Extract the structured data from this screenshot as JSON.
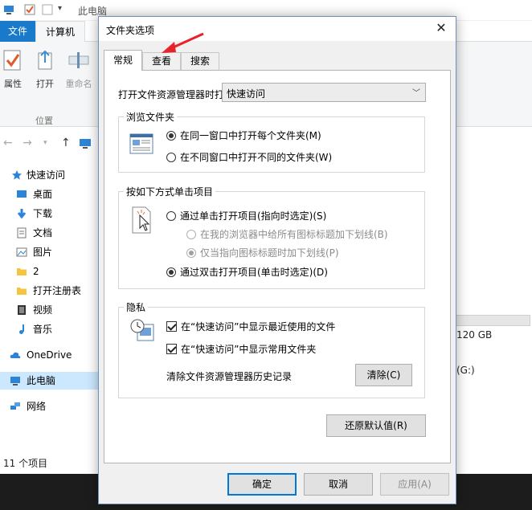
{
  "explorer": {
    "title": "此电脑",
    "tabs": {
      "file": "文件",
      "computer": "计算机"
    },
    "ribbon": {
      "properties": "属性",
      "open": "打开",
      "rename": "重命名",
      "group_location": "位置"
    },
    "sidebar": [
      {
        "label": "快速访问",
        "icon": "star-icon"
      },
      {
        "label": "桌面",
        "icon": "desktop-icon"
      },
      {
        "label": "下载",
        "icon": "download-icon"
      },
      {
        "label": "文档",
        "icon": "document-icon"
      },
      {
        "label": "图片",
        "icon": "picture-icon"
      },
      {
        "label": "2",
        "icon": "folder-icon"
      },
      {
        "label": "打开注册表",
        "icon": "folder-icon"
      },
      {
        "label": "视频",
        "icon": "video-icon"
      },
      {
        "label": "音乐",
        "icon": "music-icon"
      },
      {
        "label": "OneDrive",
        "icon": "cloud-icon"
      },
      {
        "label": "此电脑",
        "icon": "computer-icon"
      },
      {
        "label": "网络",
        "icon": "network-icon"
      }
    ],
    "status": "11 个项目",
    "drive_free": "120 GB",
    "drive_letter": "(G:)"
  },
  "dialog": {
    "title": "文件夹选项",
    "tabs": [
      "常规",
      "查看",
      "搜索"
    ],
    "open_explorer_label": "打开文件资源管理器时打",
    "open_explorer_value": "快速访问",
    "browse_group": {
      "title": "浏览文件夹",
      "same_window": "在同一窗口中打开每个文件夹(M)",
      "new_window": "在不同窗口中打开不同的文件夹(W)"
    },
    "click_group": {
      "title": "按如下方式单击项目",
      "single_click": "通过单击打开项目(指向时选定)(S)",
      "underline_all": "在我的浏览器中给所有图标标题加下划线(B)",
      "underline_point": "仅当指向图标标题时加下划线(P)",
      "double_click": "通过双击打开项目(单击时选定)(D)"
    },
    "privacy_group": {
      "title": "隐私",
      "recent_files": "在“快速访问”中显示最近使用的文件",
      "frequent_folders": "在“快速访问”中显示常用文件夹",
      "clear_label": "清除文件资源管理器历史记录",
      "clear_button": "清除(C)"
    },
    "restore_defaults": "还原默认值(R)",
    "buttons": {
      "ok": "确定",
      "cancel": "取消",
      "apply": "应用(A)"
    }
  },
  "colors": {
    "accent": "#1979ca",
    "annotation": "#e8222a",
    "selected": "#cce8ff"
  }
}
